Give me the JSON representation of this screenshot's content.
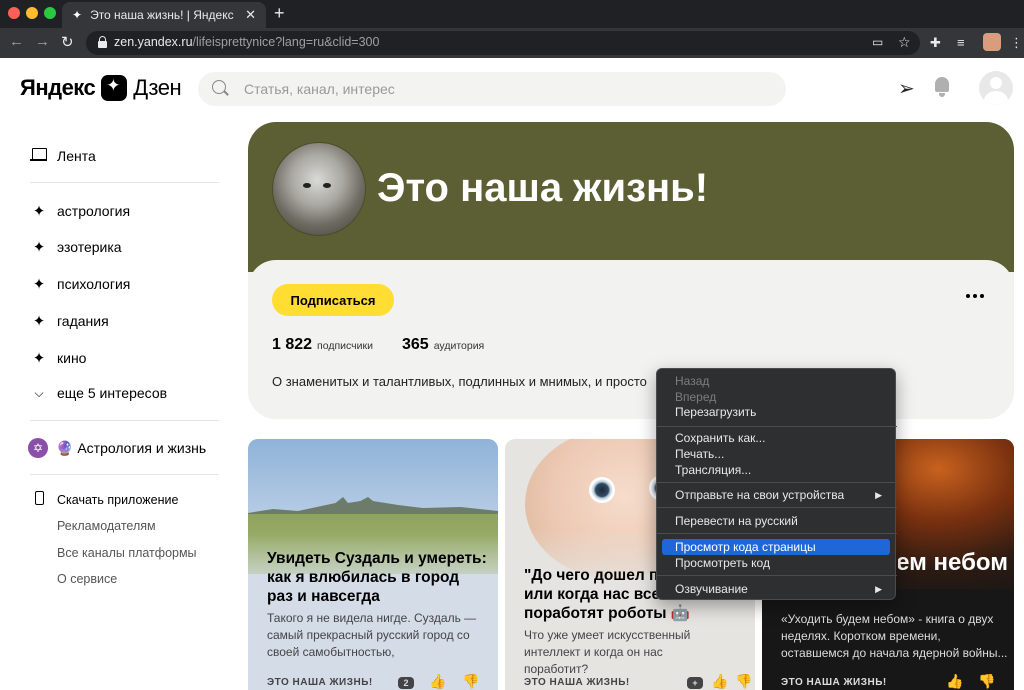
{
  "browser": {
    "tab_title": "Это наша жизнь! | Яндекс Дзен",
    "url_host": "zen.yandex.ru",
    "url_path": "/lifeisprettynice?lang=ru&clid=300",
    "new_tab_label": "+",
    "close_tab_label": "✕"
  },
  "header": {
    "logo_yandex": "Яндекс",
    "logo_dzen": "Дзен",
    "search_placeholder": "Статья, канал, интерес"
  },
  "sidebar": {
    "feed_label": "Лента",
    "interests": [
      "астрология",
      "эзотерика",
      "психология",
      "гадания",
      "кино"
    ],
    "more_label": "еще 5 интересов",
    "subscription_label": "🔮 Астрология и жизнь",
    "download_label": "Скачать приложение",
    "links": [
      "Рекламодателям",
      "Все каналы платформы",
      "О сервисе"
    ]
  },
  "channel": {
    "title": "Это наша жизнь!",
    "subscribe_label": "Подписаться",
    "subscribers_count": "1 822",
    "subscribers_label": "подписчики",
    "audience_count": "365",
    "audience_label": "аудитория",
    "description": "О знаменитых и талантливых, подлинных и мнимых, и просто"
  },
  "cards": [
    {
      "title": "Увидеть Суздаль и умереть: как я влюбилась в город раз и навсегда",
      "snippet": "Такого я не видела нигде. Суздаль — самый прекрасный русский город со своей самобытностью, особенностями...",
      "source": "ЭТО НАША ЖИЗНЬ!",
      "count": "2"
    },
    {
      "title": "\"До чего дошел прогресс\" или когда нас всех поработят роботы 🤖",
      "snippet": "Что уже умеет искусственный интеллект и когда он нас поработит?",
      "source": "ЭТО НАША ЖИЗНЬ!",
      "count": "+"
    },
    {
      "title": "Уходить будем небом",
      "snippet": "«Уходить будем небом» - книга о двух неделях. Коротком времени, оставшемся до начала ядерной войны...",
      "source": "ЭТО НАША ЖИЗНЬ!"
    }
  ],
  "context_menu": {
    "items": [
      {
        "label": "Назад",
        "disabled": true
      },
      {
        "label": "Вперед",
        "disabled": true
      },
      {
        "label": "Перезагрузить"
      },
      {
        "label": "Сохранить как..."
      },
      {
        "label": "Печать..."
      },
      {
        "label": "Трансляция..."
      },
      {
        "label": "Отправьте на свои устройства",
        "submenu": true
      },
      {
        "label": "Перевести на русский"
      },
      {
        "label": "Просмотр кода страницы",
        "selected": true
      },
      {
        "label": "Просмотреть код"
      },
      {
        "label": "Озвучивание",
        "submenu": true
      }
    ]
  },
  "colors": {
    "banner": "#5b5f33",
    "subscribe_button": "#ffdd33",
    "menu_highlight": "#1f66d9"
  }
}
